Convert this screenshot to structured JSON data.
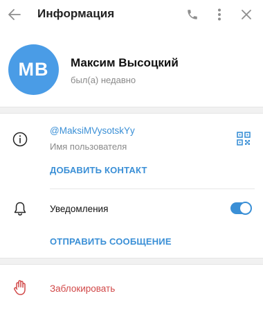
{
  "header": {
    "title": "Информация",
    "icons": [
      "back-arrow-icon",
      "phone-icon",
      "more-vertical-icon",
      "close-icon"
    ]
  },
  "profile": {
    "initials": "MB",
    "name": "Максим Высоцкий",
    "status": "был(а) недавно",
    "avatar_color": "#4a9ce6"
  },
  "info": {
    "username": "@MaksiMVysotskYy",
    "username_caption": "Имя пользователя",
    "add_contact": "Добавить контакт"
  },
  "notifications": {
    "label": "Уведомления",
    "enabled": true,
    "send_message": "Отправить сообщение"
  },
  "block": {
    "label": "Заблокировать"
  },
  "colors": {
    "accent": "#3a8fd6",
    "danger": "#d14848",
    "secondary_text": "#8a8a8a"
  }
}
